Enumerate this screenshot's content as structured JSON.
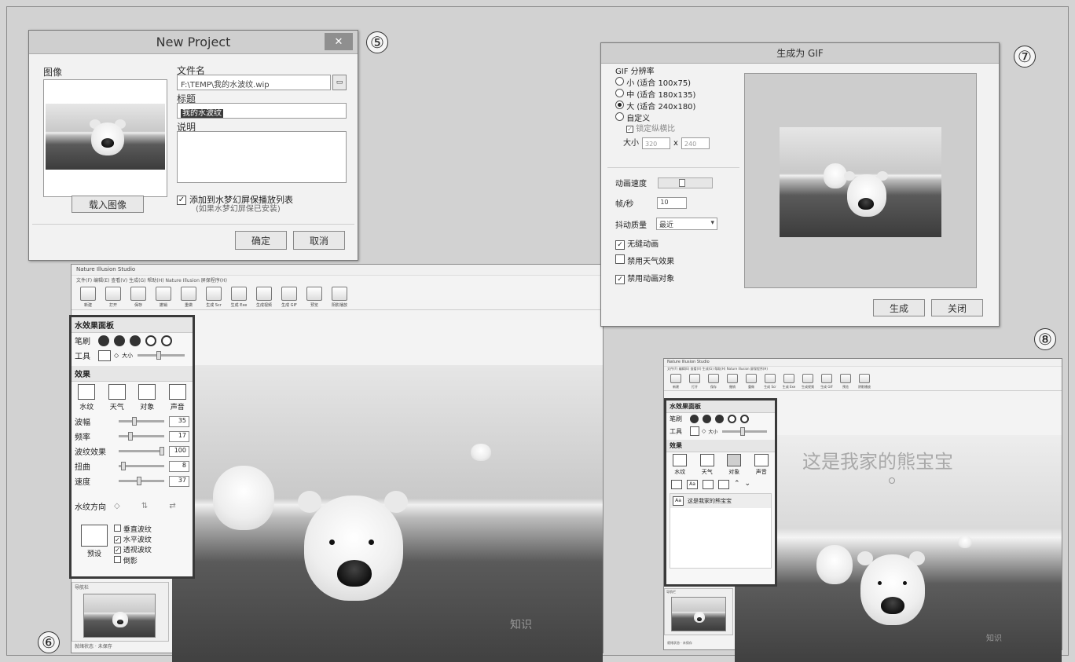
{
  "markers": {
    "m5": "⑤",
    "m6": "⑥",
    "m7": "⑦",
    "m8": "⑧"
  },
  "new_project": {
    "title": "New Project",
    "close": "✕",
    "image_label": "图像",
    "filename_label": "文件名",
    "filename_value": "F:\\TEMP\\我的水波纹.wip",
    "title_label": "标题",
    "title_value": "我的水波纹",
    "desc_label": "说明",
    "load_image": "载入图像",
    "add_slideshow": "添加到水梦幻屏保播放列表",
    "add_slideshow_note": "(如果水梦幻屏保已安装)",
    "ok": "确定",
    "cancel": "取消"
  },
  "app_left": {
    "title": "Nature Illusion Studio",
    "menu": "文件(F)  编辑(E)  查看(V)  生成(G)  帮助(H)  Nature Illusion 屏保程序(H)",
    "toolbar": [
      "新建",
      "打开",
      "保存",
      "撤销",
      "重做",
      "生成 Scr",
      "生成 Exe",
      "生成视频",
      "生成 GIF",
      "预览",
      "阴影播放"
    ],
    "panel_title": "水效果面板",
    "brush_label": "笔刷",
    "tool_label": "工具",
    "tool_size": "大小",
    "effects_label": "效果",
    "tabs": [
      "水纹",
      "天气",
      "对象",
      "声音"
    ],
    "params": [
      {
        "name": "波幅",
        "value": "35"
      },
      {
        "name": "频率",
        "value": "17"
      },
      {
        "name": "波纹效果",
        "value": "100"
      },
      {
        "name": "扭曲",
        "value": "8"
      },
      {
        "name": "速度",
        "value": "37"
      }
    ],
    "direction_label": "水纹方向",
    "preset_label": "预设",
    "options": [
      {
        "label": "垂直波纹",
        "checked": false
      },
      {
        "label": "水平波纹",
        "checked": true
      },
      {
        "label": "透视波纹",
        "checked": true
      },
      {
        "label": "倒影",
        "checked": false
      }
    ],
    "nav_label": "导航栏",
    "status": "就绪状态  ·  未保存",
    "watermark": "知识"
  },
  "gif_dialog": {
    "title": "生成为 GIF",
    "res_label": "GIF 分辨率",
    "options": [
      {
        "label": "小 (适合 100x75)",
        "on": false
      },
      {
        "label": "中 (适合 180x135)",
        "on": false
      },
      {
        "label": "大 (适合 240x180)",
        "on": true
      },
      {
        "label": "自定义",
        "on": false
      }
    ],
    "lock_ratio": "锁定纵横比",
    "size_label": "大小",
    "size_w": "320",
    "size_x": "x",
    "size_h": "240",
    "anim_speed": "动画速度",
    "fps_label": "帧/秒",
    "fps_value": "10",
    "dither_label": "抖动质量",
    "dither_value": "最近",
    "seamless": "无缝动画",
    "no_weather": "禁用天气效果",
    "no_objects": "禁用动画对象",
    "generate": "生成",
    "close": "关闭"
  },
  "app_right": {
    "title": "Nature Illusion Studio",
    "menu": "文件(F)  编辑(E)  查看(V)  生成(G)  帮助(H)  Nature Illusion 屏保程序(H)",
    "toolbar": [
      "新建",
      "打开",
      "保存",
      "撤销",
      "重做",
      "生成 Scr",
      "生成 Exe",
      "生成视频",
      "生成 GIF",
      "预览",
      "阴影播放"
    ],
    "panel_title": "水效果面板",
    "brush_label": "笔刷",
    "tool_label": "工具",
    "tool_size": "大小",
    "effects_label": "效果",
    "tabs": [
      "水纹",
      "天气",
      "对象",
      "声音"
    ],
    "object_item": "这是我家的熊宝宝",
    "overlay_text": "这是我家的熊宝宝",
    "nav_label": "导航栏",
    "status": "就绪状态  ·  未保存",
    "watermark": "知识"
  }
}
